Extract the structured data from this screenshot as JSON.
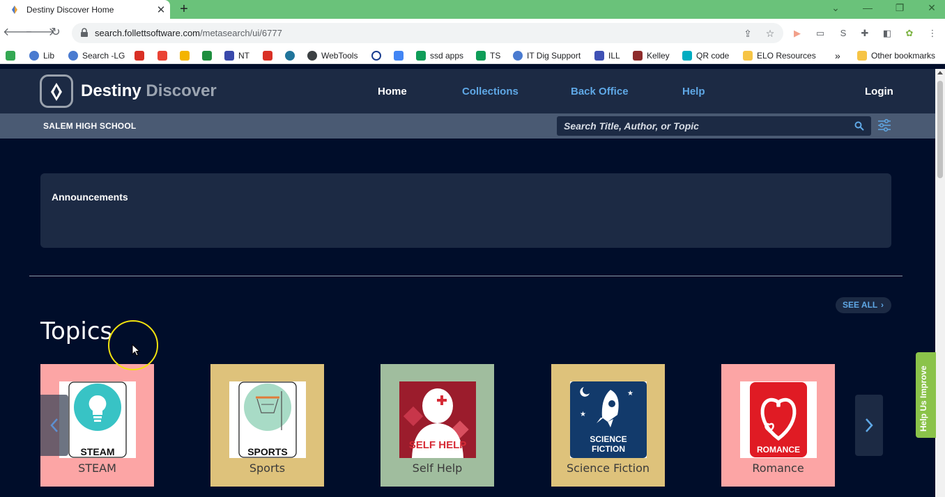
{
  "browser": {
    "tab_title": "Destiny Discover Home",
    "new_tab": "+",
    "url_host": "search.follettsoftware.com",
    "url_path": "/metasearch/ui/6777",
    "bookmarks": [
      {
        "label": "",
        "icon": "c-green-icon",
        "color": "#34a853"
      },
      {
        "label": "Lib",
        "icon": "globe-icon",
        "color": "#4a7bd0"
      },
      {
        "label": "Search -LG",
        "icon": "globe-icon",
        "color": "#4a7bd0"
      },
      {
        "label": "",
        "icon": "f-red-icon",
        "color": "#d93025"
      },
      {
        "label": "",
        "icon": "gmail-icon",
        "color": "#ea4335"
      },
      {
        "label": "",
        "icon": "classroom-icon",
        "color": "#f4b400"
      },
      {
        "label": "",
        "icon": "bird-icon",
        "color": "#1e8e3e"
      },
      {
        "label": "NT",
        "icon": "figure-icon",
        "color": "#3949ab"
      },
      {
        "label": "",
        "icon": "red-figure-icon",
        "color": "#d93025"
      },
      {
        "label": "",
        "icon": "wordpress-icon",
        "color": "#21759b"
      },
      {
        "label": "WebTools",
        "icon": "world-icon",
        "color": "#3c4043"
      },
      {
        "label": "",
        "icon": "ring-icon",
        "color": "#1a3d8f"
      },
      {
        "label": "",
        "icon": "docs-icon",
        "color": "#4285f4"
      },
      {
        "label": "ssd apps",
        "icon": "sheets-icon",
        "color": "#0f9d58"
      },
      {
        "label": "TS",
        "icon": "sheets-icon",
        "color": "#0f9d58"
      },
      {
        "label": "IT Dig Support",
        "icon": "globe-icon",
        "color": "#4a7bd0"
      },
      {
        "label": "ILL",
        "icon": "owl-icon",
        "color": "#3f51b5"
      },
      {
        "label": "Kelley",
        "icon": "people-icon",
        "color": "#8e2b2b"
      },
      {
        "label": "QR code",
        "icon": "qr-icon",
        "color": "#00acc1"
      },
      {
        "label": "ELO Resources",
        "icon": "folder-icon",
        "color": "#f6c445"
      }
    ],
    "overflow": "»",
    "other_bookmarks": "Other bookmarks"
  },
  "site": {
    "brand_main": "Destiny",
    "brand_accent": "Discover",
    "nav": [
      "Home",
      "Collections",
      "Back Office",
      "Help"
    ],
    "login": "Login",
    "school": "SALEM HIGH SCHOOL",
    "search_placeholder": "Search Title, Author, or Topic"
  },
  "announcements": {
    "title": "Announcements"
  },
  "topics": {
    "title": "Topics",
    "see_all": "SEE ALL",
    "items": [
      {
        "label": "STEAM",
        "bg": "#fca5a5",
        "icon": "lightbulb-icon",
        "caption": "STEAM"
      },
      {
        "label": "Sports",
        "bg": "#dec27b",
        "icon": "basketball-hoop-icon",
        "caption": "SPORTS"
      },
      {
        "label": "Self Help",
        "bg": "#a0bd9e",
        "icon": "self-help-icon",
        "caption": "SELF HELP"
      },
      {
        "label": "Science Fiction",
        "bg": "#dec27b",
        "icon": "rocket-icon",
        "caption": "SCIENCE FICTION"
      },
      {
        "label": "Romance",
        "bg": "#fca5a5",
        "icon": "heart-icon",
        "caption": "ROMANCE"
      }
    ]
  },
  "help_tab": "Help Us Improve"
}
